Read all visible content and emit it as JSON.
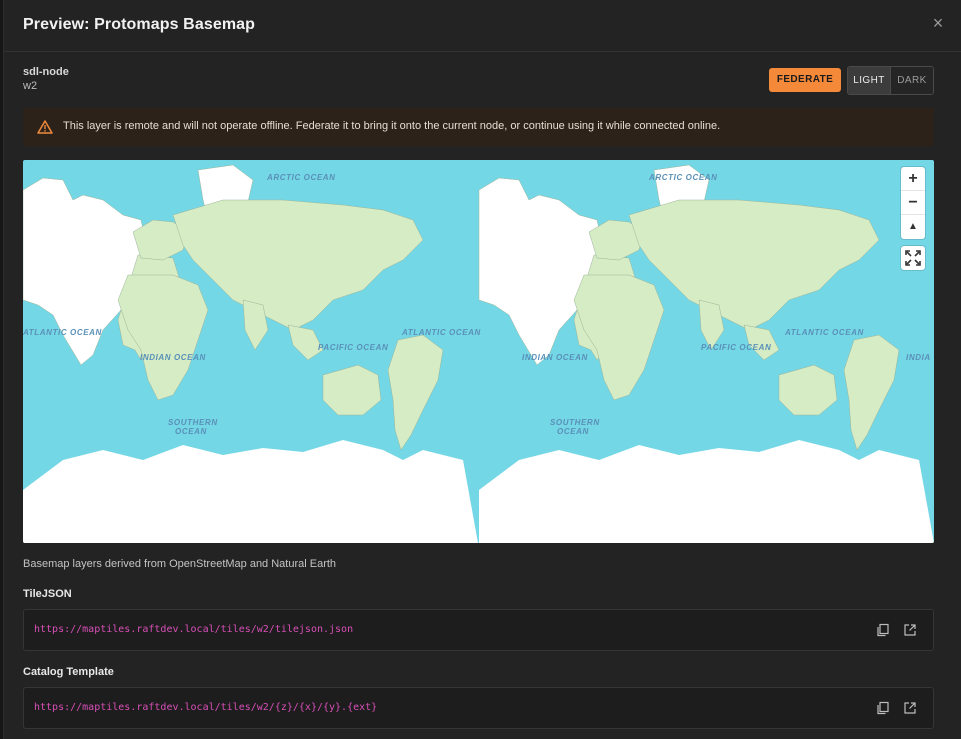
{
  "modal": {
    "title": "Preview: Protomaps Basemap",
    "close_label": "×"
  },
  "node": {
    "name": "sdl-node",
    "subtitle": "w2"
  },
  "actions": {
    "federate_label": "FEDERATE",
    "theme_options": [
      "LIGHT",
      "DARK"
    ],
    "theme_selected": "LIGHT",
    "accent_color": "#f5893a"
  },
  "warning": {
    "icon": "warning-triangle-icon",
    "text": "This layer is remote and will not operate offline. Federate it to bring it onto the current node, or continue using it while connected online."
  },
  "map": {
    "ocean_labels": [
      "ARCTIC OCEAN",
      "ARCTIC OCEAN",
      "ATLANTIC OCEAN",
      "ATLANTIC OCEAN",
      "ATLANTIC OCEAN",
      "INDIAN OCEAN",
      "INDIAN OCEAN",
      "INDIA",
      "PACIFIC OCEAN",
      "PACIFIC OCEAN",
      "SOUTHERN\nOCEAN",
      "SOUTHERN\nOCEAN"
    ],
    "controls": {
      "zoom_in": "+",
      "zoom_out": "−",
      "compass": "▲"
    },
    "ocean_color": "#74d7e6",
    "land_color": "#d5ecc4"
  },
  "attribution": "Basemap layers derived from OpenStreetMap and Natural Earth",
  "tilejson": {
    "label": "TileJSON",
    "url": "https://maptiles.raftdev.local/tiles/w2/tilejson.json"
  },
  "catalog": {
    "label": "Catalog Template",
    "url": "https://maptiles.raftdev.local/tiles/w2/{z}/{x}/{y}.{ext}"
  }
}
